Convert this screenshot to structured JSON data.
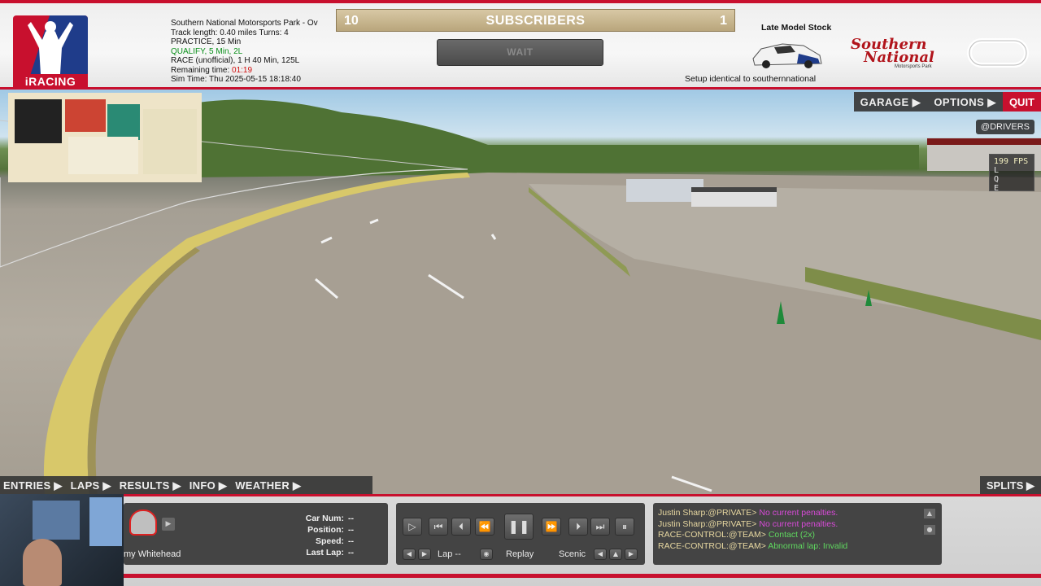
{
  "header": {
    "logo_text": "iRACING",
    "session": {
      "track_line": "Southern National Motorsports Park - Ov",
      "track_length": "Track length: 0.40 miles Turns: 4",
      "practice": "PRACTICE, 15 Min",
      "qualify": "QUALIFY, 5 Min, 2L",
      "race": "RACE (unofficial), 1 H 40 Min, 125L",
      "remaining_label": "Remaining time: ",
      "remaining_value": "01:19",
      "sim_time": "Sim Time: Thu 2025-05-15 18:18:40"
    },
    "subscribers": {
      "left_count": "10",
      "label": "SUBSCRIBERS",
      "right_count": "1"
    },
    "wait_button": "WAIT",
    "car_class": "Late Model Stock",
    "setup_note": "Setup identical to southernnational",
    "track_logo": {
      "line1": "Southern",
      "line2": "National",
      "line3": "Motorsports Park"
    }
  },
  "right_menu": {
    "garage": "GARAGE ▶",
    "options": "OPTIONS ▶",
    "quit": "QUIT"
  },
  "overlay": {
    "drivers_tag": "@DRIVERS",
    "fps": "199 FPS",
    "lqe": [
      "L",
      "Q",
      "E"
    ]
  },
  "tabs": [
    "ENTRIES ▶",
    "LAPS ▶",
    "RESULTS ▶",
    "INFO ▶",
    "WEATHER ▶"
  ],
  "splits": "SPLITS ▶",
  "driver": {
    "name": "my Whitehead",
    "stats": [
      {
        "label": "Car Num:",
        "value": "--"
      },
      {
        "label": "Position:",
        "value": "--"
      },
      {
        "label": "Speed:",
        "value": "--"
      },
      {
        "label": "Last Lap:",
        "value": "--"
      }
    ]
  },
  "replay": {
    "lap_label": "Lap --",
    "replay_label": "Replay",
    "scenic_label": "Scenic"
  },
  "chat": [
    {
      "user": "Justin Sharp:@PRIVATE> ",
      "msg": "No current penalties.",
      "tone": "m"
    },
    {
      "user": "Justin Sharp:@PRIVATE> ",
      "msg": "No current penalties.",
      "tone": "m"
    },
    {
      "user": "RACE-CONTROL:@TEAM> ",
      "msg": "Contact (2x)",
      "tone": "g"
    },
    {
      "user": "RACE-CONTROL:@TEAM> ",
      "msg": "Abnormal lap: Invalid",
      "tone": "g"
    }
  ],
  "colors": {
    "brand_red": "#c8102e",
    "brand_blue": "#1f3c8a",
    "gold": "#b9a67c"
  }
}
